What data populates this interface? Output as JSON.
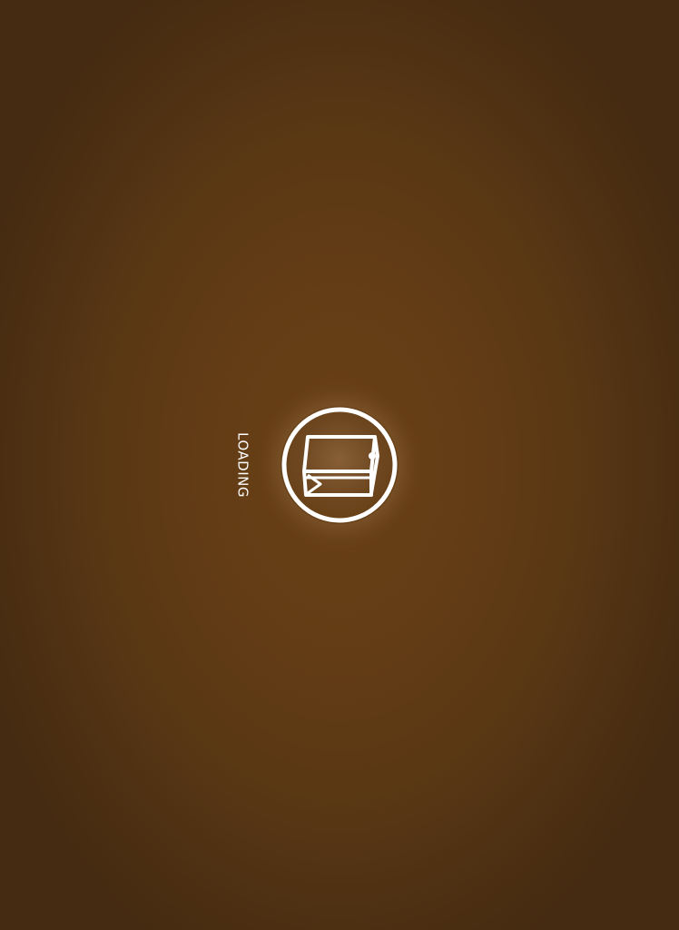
{
  "loading_screen": {
    "label": "LOADING",
    "logo_icon": "book-in-circle-icon"
  },
  "colors": {
    "background_center": "#6a4117",
    "background_edge": "#452b11",
    "foreground": "#ffffff"
  }
}
